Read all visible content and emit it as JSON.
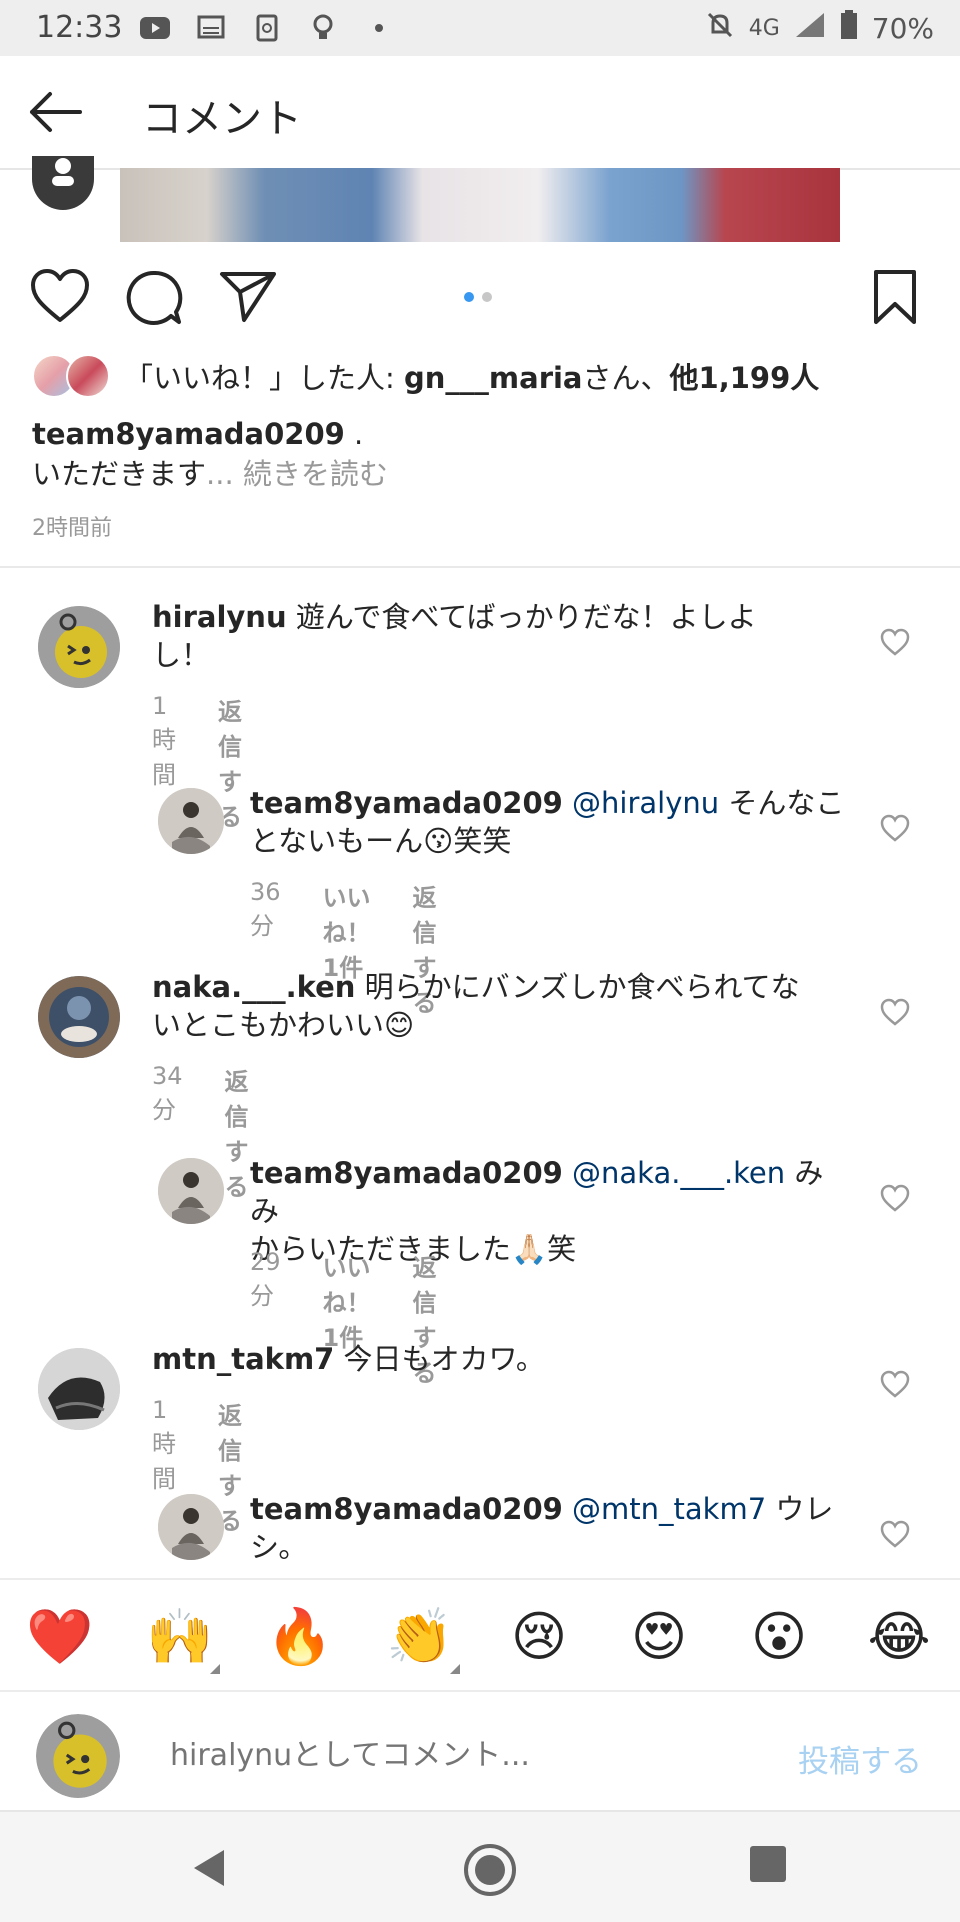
{
  "status_bar": {
    "time": "12:33",
    "network": "4G",
    "battery": "70%",
    "icons": [
      "youtube-icon",
      "cast-icon",
      "nfc-icon",
      "bulb-icon",
      "dot-icon",
      "mute-icon",
      "signal-icon",
      "battery-icon"
    ]
  },
  "app_bar": {
    "title": "コメント"
  },
  "post": {
    "likes_prefix": "「いいね！」した人: ",
    "likes_user": "gn___maria",
    "likes_mid": "さん、",
    "likes_others": "他1,199人",
    "caption_user": "team8yamada0209",
    "caption_text": " .",
    "caption_line2": "いただきます",
    "more_label": "... 続きを読む",
    "time": "2時間前",
    "carousel_dots": 2,
    "carousel_active": 1
  },
  "comments": [
    {
      "user": "hiralynu",
      "text_line1": "遊んで食べてばっかりだな！よしよ",
      "text_line2": "し！",
      "time": "1時間",
      "reply_label": "返信する"
    },
    {
      "user": "team8yamada0209",
      "mention": "@hiralynu",
      "text_line1_after": " そんなこ",
      "text_line2": "とないもーん😗笑笑",
      "time": "36分",
      "likes_label": "いいね！1件",
      "reply_label": "返信する"
    },
    {
      "user": "naka.___.ken",
      "text_line1": " 明らかにバンズしか食べられてな",
      "text_line2": "いとこもかわいい😊",
      "time": "34分",
      "reply_label": "返信する"
    },
    {
      "user": "team8yamada0209",
      "mention": "@naka.___.ken",
      "text_line1_after": " みみ",
      "text_line2": "からいただきました🙏🏻笑",
      "time": "29分",
      "likes_label": "いいね！1件",
      "reply_label": "返信する"
    },
    {
      "user": "mtn_takm7",
      "text_line1": " 今日もオカワ。",
      "time": "1時間",
      "reply_label": "返信する"
    },
    {
      "user": "team8yamada0209",
      "mention": "@mtn_takm7",
      "text_line1_after": " ウレ",
      "text_line2": "シ。"
    }
  ],
  "emoji_bar": [
    "❤️",
    "🙌",
    "🔥",
    "👏",
    "😢",
    "😍",
    "😮",
    "😂"
  ],
  "input": {
    "placeholder": "hiralynuとしてコメント...",
    "post_label": "投稿する"
  },
  "colors": {
    "accent_blue": "#3897f0",
    "mention_blue": "#003569",
    "muted": "#999999",
    "post_button_disabled": "#a8d1f2"
  }
}
